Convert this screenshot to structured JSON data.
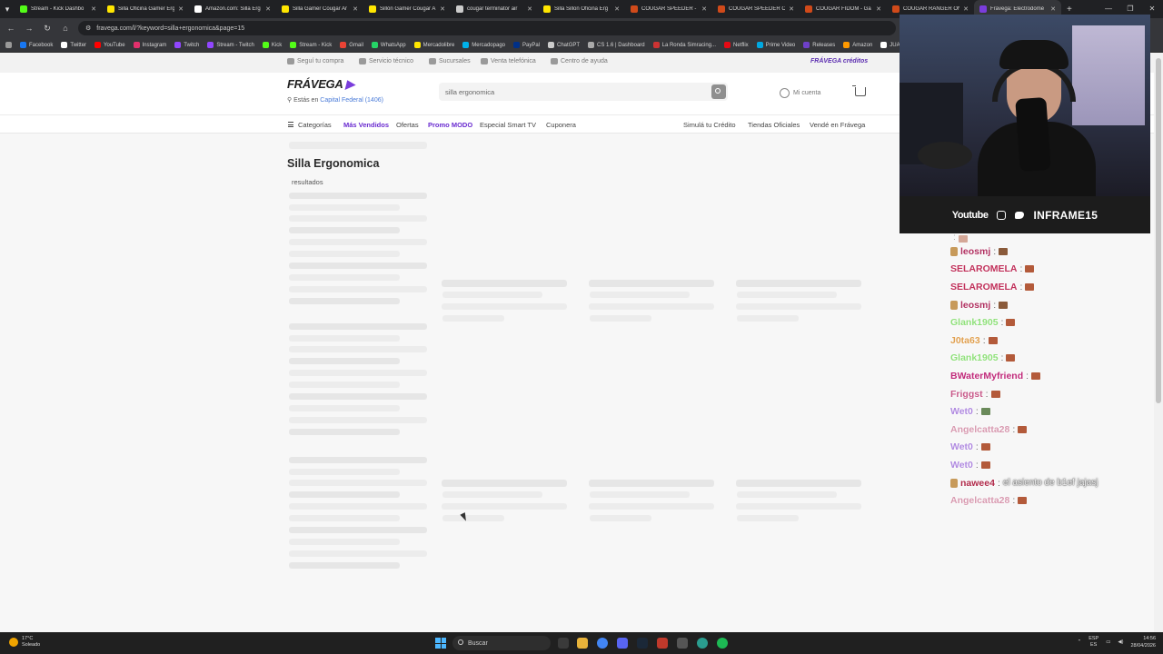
{
  "browser": {
    "tabs": [
      {
        "label": "Stream - Kick Dashbo",
        "color": "#53fc18"
      },
      {
        "label": "Silla Oficina Gamer Erg",
        "color": "#ffe600"
      },
      {
        "label": "Amazon.com: Silla Erg",
        "color": "#ffffff"
      },
      {
        "label": "Silla Gamer Cougar Ar",
        "color": "#ffe600"
      },
      {
        "label": "Sillón Gamer Cougar A",
        "color": "#ffe600"
      },
      {
        "label": "cougar terminator air",
        "color": "#cccccc"
      },
      {
        "label": "Silla Sillon Oficina Erg",
        "color": "#ffe600"
      },
      {
        "label": "COUGAR SPEEDER - E",
        "color": "#d04a1a"
      },
      {
        "label": "COUGAR SPEEDER ON",
        "color": "#d04a1a"
      },
      {
        "label": "COUGAR FIDOM - Ga",
        "color": "#d04a1a"
      },
      {
        "label": "COUGAR RANGER ON",
        "color": "#d04a1a"
      },
      {
        "label": "Frávega: Electrodomé",
        "color": "#7a3ddc",
        "active": true
      }
    ],
    "url": "fravega.com/l/?keyword=silla+ergonomica&page=15",
    "bookmarks": [
      {
        "label": "Facebook",
        "color": "#1877f2"
      },
      {
        "label": "Twitter",
        "color": "#ffffff"
      },
      {
        "label": "YouTube",
        "color": "#ff0000"
      },
      {
        "label": "Instagram",
        "color": "#e1306c"
      },
      {
        "label": "Twitch",
        "color": "#9146ff"
      },
      {
        "label": "Stream - Twitch",
        "color": "#9146ff"
      },
      {
        "label": "Kick",
        "color": "#53fc18"
      },
      {
        "label": "Stream - Kick",
        "color": "#53fc18"
      },
      {
        "label": "Gmail",
        "color": "#ea4335"
      },
      {
        "label": "WhatsApp",
        "color": "#25d366"
      },
      {
        "label": "Mercadolibre",
        "color": "#ffe600"
      },
      {
        "label": "Mercadopago",
        "color": "#00b1ea"
      },
      {
        "label": "PayPal",
        "color": "#003087"
      },
      {
        "label": "ChatGPT",
        "color": "#cccccc"
      },
      {
        "label": "CS 1.6 | Dashboard",
        "color": "#aaaaaa"
      },
      {
        "label": "La Ronda Simracing...",
        "color": "#cc3333"
      },
      {
        "label": "Netflix",
        "color": "#e50914"
      },
      {
        "label": "Prime Video",
        "color": "#00a8e1"
      },
      {
        "label": "Releases",
        "color": "#6e40c9"
      },
      {
        "label": "Amazon",
        "color": "#ff9900"
      },
      {
        "label": "JUAN",
        "color": "#ffffff"
      }
    ]
  },
  "site": {
    "topbar": {
      "items": [
        "Seguí tu compra",
        "Servicio técnico",
        "Sucursales",
        "Venta telefónica",
        "Centro de ayuda"
      ],
      "credits": "FRÁVEGA créditos"
    },
    "logo": "FRÁVEGA",
    "location_prefix": "Estás en",
    "location_city": "Capital Federal (1406)",
    "search_value": "silla ergonomica",
    "account_label": "Mi cuenta",
    "nav": {
      "categories": "Categorías",
      "items": [
        {
          "label": "Más Vendidos",
          "purple": true
        },
        {
          "label": "Ofertas",
          "purple": false
        },
        {
          "label": "Promo MODO",
          "purple": true
        },
        {
          "label": "Especial Smart TV",
          "purple": false
        },
        {
          "label": "Cuponera",
          "purple": false
        }
      ],
      "right_items": [
        "Simulá tu Crédito",
        "Tiendas Oficiales",
        "Vendé en Frávega"
      ]
    },
    "page_title": "Silla Ergonomica",
    "results_label": "resultados"
  },
  "stream": {
    "socials_youtube": "Youtube",
    "brand": "INFRAME15",
    "chat": [
      {
        "user": "",
        "color": "#a0a0c0",
        "cut": true,
        "emote": "r"
      },
      {
        "user": "leosmj",
        "color": "#b03060",
        "badge": true,
        "emote": "p"
      },
      {
        "user": "SELAROMELA",
        "color": "#c0305a",
        "emote": "r"
      },
      {
        "user": "SELAROMELA",
        "color": "#c0305a",
        "emote": "r"
      },
      {
        "user": "leosmj",
        "color": "#b03060",
        "badge": true,
        "emote": "p"
      },
      {
        "user": "Glank1905",
        "color": "#8fe07a",
        "emote": "r"
      },
      {
        "user": "J0ta63",
        "color": "#e0a050",
        "emote": "r"
      },
      {
        "user": "Glank1905",
        "color": "#8fe07a",
        "emote": "r"
      },
      {
        "user": "BWaterMyfriend",
        "color": "#c02a7a",
        "emote": "r"
      },
      {
        "user": "Friggst",
        "color": "#c85a8a",
        "emote": "r"
      },
      {
        "user": "Wet0",
        "color": "#b08ae0",
        "emote": "g"
      },
      {
        "user": "Angelcatta28",
        "color": "#d89ab0",
        "emote": "r"
      },
      {
        "user": "Wet0",
        "color": "#b08ae0",
        "emote": "r"
      },
      {
        "user": "Wet0",
        "color": "#b08ae0",
        "emote": "r"
      },
      {
        "user": "nawee4",
        "color": "#b02a4a",
        "badge": true,
        "text": "el asiento de b1ef jajasj"
      },
      {
        "user": "Angelcatta28",
        "color": "#d89ab0",
        "emote": "r"
      }
    ]
  },
  "taskbar": {
    "temp": "17°C",
    "weather": "Soleado",
    "search": "Buscar",
    "lang": "ESP",
    "lang2": "ES",
    "time": "14:56",
    "date": "28/04/2026"
  }
}
